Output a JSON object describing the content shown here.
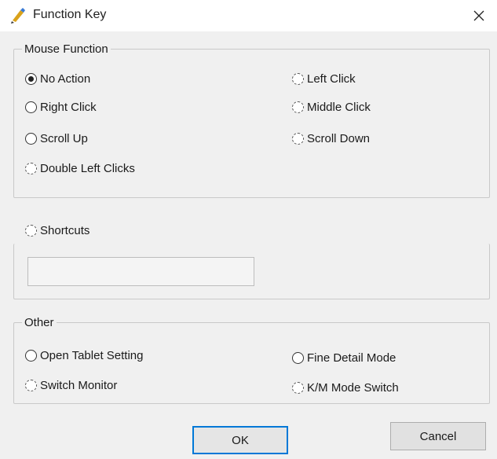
{
  "window": {
    "title": "Function Key"
  },
  "mouse_function": {
    "legend": "Mouse Function",
    "options": [
      {
        "label": "No Action",
        "checked": true
      },
      {
        "label": "Left Click",
        "checked": false
      },
      {
        "label": "Right Click",
        "checked": false
      },
      {
        "label": "Middle Click",
        "checked": false
      },
      {
        "label": "Scroll Up",
        "checked": false
      },
      {
        "label": "Scroll Down",
        "checked": false
      },
      {
        "label": "Double Left Clicks",
        "checked": false
      }
    ]
  },
  "shortcuts": {
    "label": "Shortcuts",
    "checked": false,
    "value": ""
  },
  "other": {
    "legend": "Other",
    "options": [
      {
        "label": "Open Tablet Setting",
        "checked": false
      },
      {
        "label": "Fine Detail Mode",
        "checked": false
      },
      {
        "label": "Switch Monitor",
        "checked": false
      },
      {
        "label": "K/M Mode Switch",
        "checked": false
      }
    ]
  },
  "buttons": {
    "ok": "OK",
    "cancel": "Cancel"
  },
  "colors": {
    "accent": "#0078d7",
    "background": "#f0f0f0"
  }
}
